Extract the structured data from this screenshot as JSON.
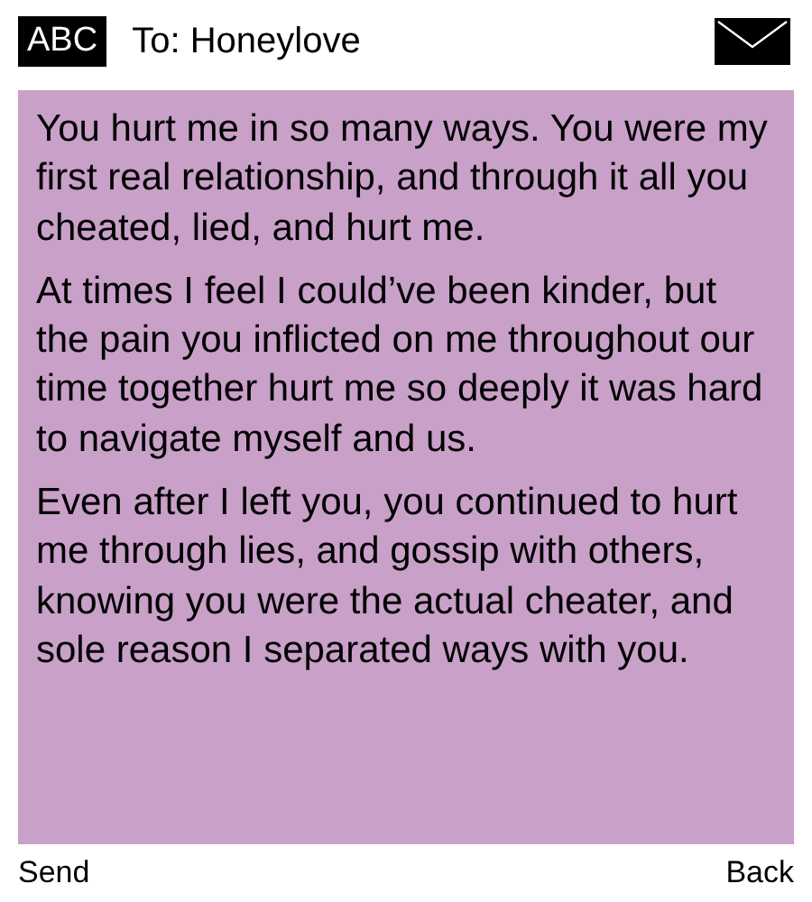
{
  "header": {
    "input_mode": "ABC",
    "recipient": "To: Honeylove"
  },
  "message": {
    "paragraphs": [
      "You hurt me in so many ways. You were my first real relationship, and through it all you cheated, lied, and hurt me.",
      "At times I feel I could’ve been kinder, but the pain you inflicted on me throughout our time together hurt me so deeply it was hard to navigate myself and us.",
      "Even after I left you, you continued to hurt me through lies, and gossip with others, knowing you were the actual cheater, and sole reason I separated ways with you."
    ]
  },
  "softkeys": {
    "left": "Send",
    "right": "Back"
  }
}
